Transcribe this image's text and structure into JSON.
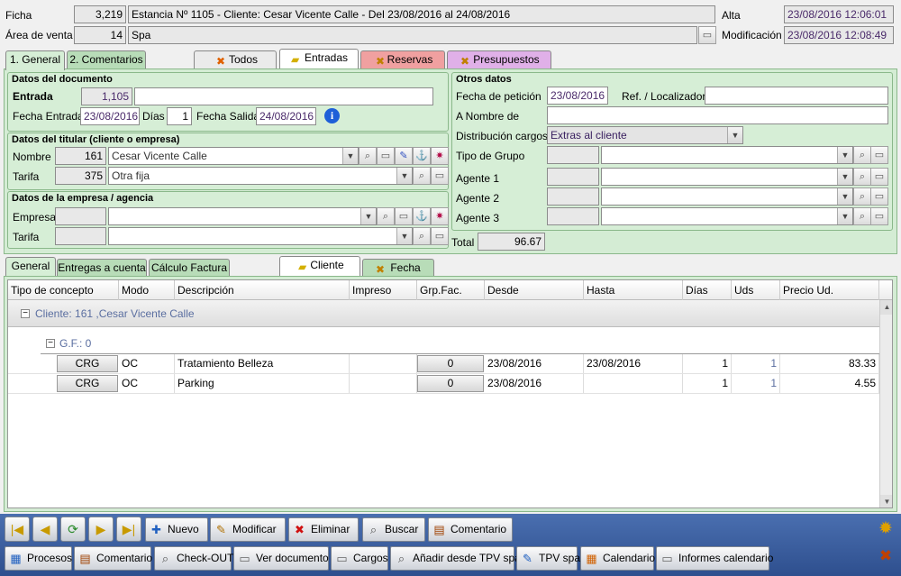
{
  "header": {
    "ficha_label": "Ficha",
    "ficha_value": "3,219",
    "ficha_desc": "Estancia Nº 1105 - Cliente: Cesar Vicente Calle - Del 23/08/2016 al 24/08/2016",
    "area_label": "Área de venta",
    "area_value": "14",
    "area_desc": "Spa",
    "alta_label": "Alta",
    "alta_value": "23/08/2016  12:06:01",
    "mod_label": "Modificación",
    "mod_value": "23/08/2016  12:08:49"
  },
  "main_tabs": {
    "general": "1. General",
    "comentarios": "2. Comentarios"
  },
  "filter_tabs": {
    "todos": "Todos",
    "entradas": "Entradas",
    "reservas": "Reservas",
    "presupuestos": "Presupuestos"
  },
  "doc": {
    "title": "Datos del documento",
    "entrada_label": "Entrada",
    "entrada_value": "1,105",
    "entrada_desc": "",
    "fecha_entrada_label": "Fecha Entrada",
    "fecha_entrada": "23/08/2016",
    "dias_label": "Días",
    "dias": "1",
    "fecha_salida_label": "Fecha Salida",
    "fecha_salida": "24/08/2016"
  },
  "titular": {
    "title": "Datos del titular (cliente o empresa)",
    "nombre_label": "Nombre",
    "nombre_code": "161",
    "nombre_value": "Cesar Vicente Calle",
    "tarifa_label": "Tarifa",
    "tarifa_code": "375",
    "tarifa_value": "Otra fija"
  },
  "empresa": {
    "title": "Datos de la empresa / agencia",
    "empresa_label": "Empresa",
    "tarifa_label": "Tarifa"
  },
  "otros": {
    "title": "Otros datos",
    "fecha_peticion_label": "Fecha de petición",
    "fecha_peticion": "23/08/2016",
    "ref_label": "Ref. / Localizador",
    "a_nombre_label": "A Nombre de",
    "distribucion_label": "Distribución cargos",
    "distribucion_value": "Extras al cliente",
    "tipo_grupo_label": "Tipo de Grupo",
    "agente1_label": "Agente 1",
    "agente2_label": "Agente 2",
    "agente3_label": "Agente 3",
    "total_label": "Total",
    "total_value": "96.67"
  },
  "lower_tabs": {
    "general": "General",
    "entregas": "Entregas a cuenta",
    "calculo": "Cálculo Factura",
    "cliente": "Cliente",
    "fecha": "Fecha"
  },
  "table": {
    "headers": [
      "Tipo de concepto",
      "Modo",
      "Descripción",
      "Impreso",
      "Grp.Fac.",
      "Desde",
      "Hasta",
      "Días",
      "Uds",
      "Precio Ud."
    ],
    "group_label": "Cliente: 161 ,Cesar Vicente Calle",
    "subgroup_label": "G.F.: 0",
    "rows": [
      {
        "tipo": "CRG",
        "modo": "OC",
        "desc": "Tratamiento Belleza",
        "grp": "0",
        "desde": "23/08/2016",
        "hasta": "23/08/2016",
        "dias": "1",
        "uds": "1",
        "precio": "83.33"
      },
      {
        "tipo": "CRG",
        "modo": "OC",
        "desc": "Parking",
        "grp": "0",
        "desde": "23/08/2016",
        "hasta": "",
        "dias": "1",
        "uds": "1",
        "precio": "4.55"
      }
    ]
  },
  "toolbar1": {
    "nuevo": "Nuevo",
    "modificar": "Modificar",
    "eliminar": "Eliminar",
    "buscar": "Buscar",
    "comentario": "Comentario"
  },
  "toolbar2": {
    "procesos": "Procesos",
    "comentario": "Comentario",
    "checkout": "Check-OUT",
    "ver_documento": "Ver documento",
    "cargos": "Cargos",
    "anadir_tpv": "Añadir desde TPV spa",
    "tpv_spa": "TPV spa",
    "calendario": "Calendario",
    "informes": "Informes calendario"
  }
}
